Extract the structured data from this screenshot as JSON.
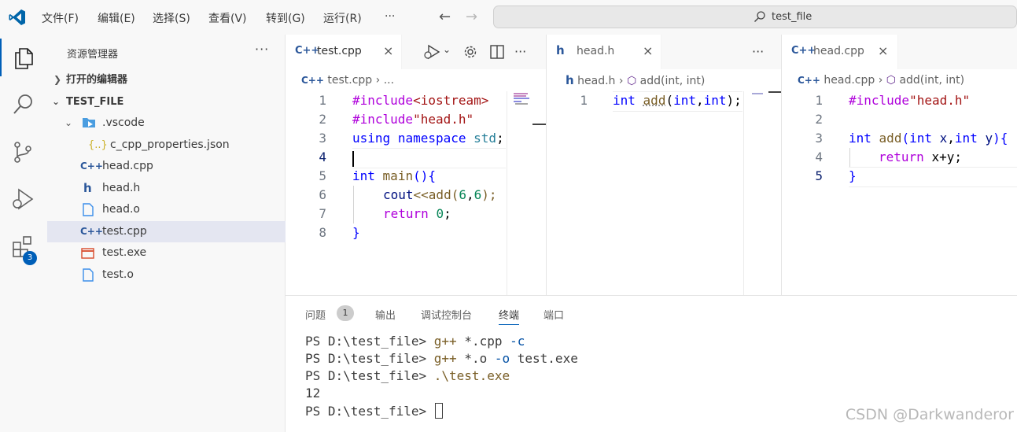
{
  "titlebar": {
    "menu": [
      "文件(F)",
      "编辑(E)",
      "选择(S)",
      "查看(V)",
      "转到(G)",
      "运行(R)"
    ],
    "more": "···",
    "search_text": "test_file"
  },
  "activity": {
    "extensions_badge": "3"
  },
  "sidebar": {
    "title": "资源管理器",
    "more": "···",
    "open_editors": "打开的编辑器",
    "folder": "TEST_FILE",
    "items": [
      {
        "label": ".vscode",
        "icon": "folder-icon"
      },
      {
        "label": "c_cpp_properties.json",
        "icon": "json-icon",
        "glyph": "{..}"
      },
      {
        "label": "head.cpp",
        "icon": "cpp-icon",
        "glyph": "C++"
      },
      {
        "label": "head.h",
        "icon": "header-icon",
        "glyph": "h"
      },
      {
        "label": "head.o",
        "icon": "file-icon"
      },
      {
        "label": "test.cpp",
        "icon": "cpp-icon",
        "glyph": "C++"
      },
      {
        "label": "test.exe",
        "icon": "exe-icon"
      },
      {
        "label": "test.o",
        "icon": "file-icon"
      }
    ]
  },
  "editors": {
    "g1": {
      "tab": {
        "glyph": "C++",
        "label": "test.cpp",
        "close": "×"
      },
      "more": "···",
      "crumbs": [
        "test.cpp",
        "›",
        "..."
      ],
      "lines": [
        "1",
        "2",
        "3",
        "4",
        "5",
        "6",
        "7",
        "8"
      ]
    },
    "g2": {
      "tab": {
        "glyph": "h",
        "label": "head.h",
        "close": "×"
      },
      "more": "···",
      "crumbs": [
        "head.h",
        "›",
        "add(int, int)"
      ],
      "lines": [
        "1"
      ]
    },
    "g3": {
      "tab": {
        "glyph": "C++",
        "label": "head.cpp",
        "close": "×"
      },
      "crumbs": [
        "head.cpp",
        "›",
        "add(int, int)"
      ],
      "lines": [
        "1",
        "2",
        "3",
        "4",
        "5"
      ]
    }
  },
  "code": {
    "t1": "#include",
    "t2": "<iostream>",
    "t3": "#include",
    "t4": "\"head.h\"",
    "t5": "using",
    "t6": "namespace",
    "t7": "std",
    "t8": ";",
    "t9": "int",
    "t10": "main",
    "t11": "(){",
    "t12": "cout",
    "t13": "<<",
    "t14": "add",
    "t15": "(",
    "t16": "6",
    "t17": ",",
    "t18": "6",
    "t19": ");",
    "t20": "return",
    "t21": "0",
    "t22": ";",
    "t23": "}",
    "h1": "int",
    "h2": "add",
    "h3": "(",
    "h4": "int",
    "h5": ",",
    "h6": "int",
    "h7": ");",
    "c1": "#include",
    "c2": "\"head.h\"",
    "c3": "int",
    "c4": "add",
    "c5": "(",
    "c6": "int",
    "c7": "x",
    "c8": ",",
    "c9": "int",
    "c10": "y",
    "c11": "){",
    "c12": "return",
    "c13": "x+y;",
    "c14": "}"
  },
  "panel": {
    "tabs": [
      "问题",
      "输出",
      "调试控制台",
      "终端",
      "端口"
    ],
    "problems_count": "1",
    "terminal": {
      "prompt": "PS D:\\test_file>",
      "l1_cmd": "g++",
      "l1_a": "*.cpp",
      "l1_b": "-c",
      "l2_cmd": "g++",
      "l2_a": "*.o",
      "l2_b": "-o",
      "l2_c": "test.exe",
      "l3_cmd": ".\\test.exe",
      "l4": "12"
    }
  },
  "watermark": "CSDN @Darkwanderor"
}
